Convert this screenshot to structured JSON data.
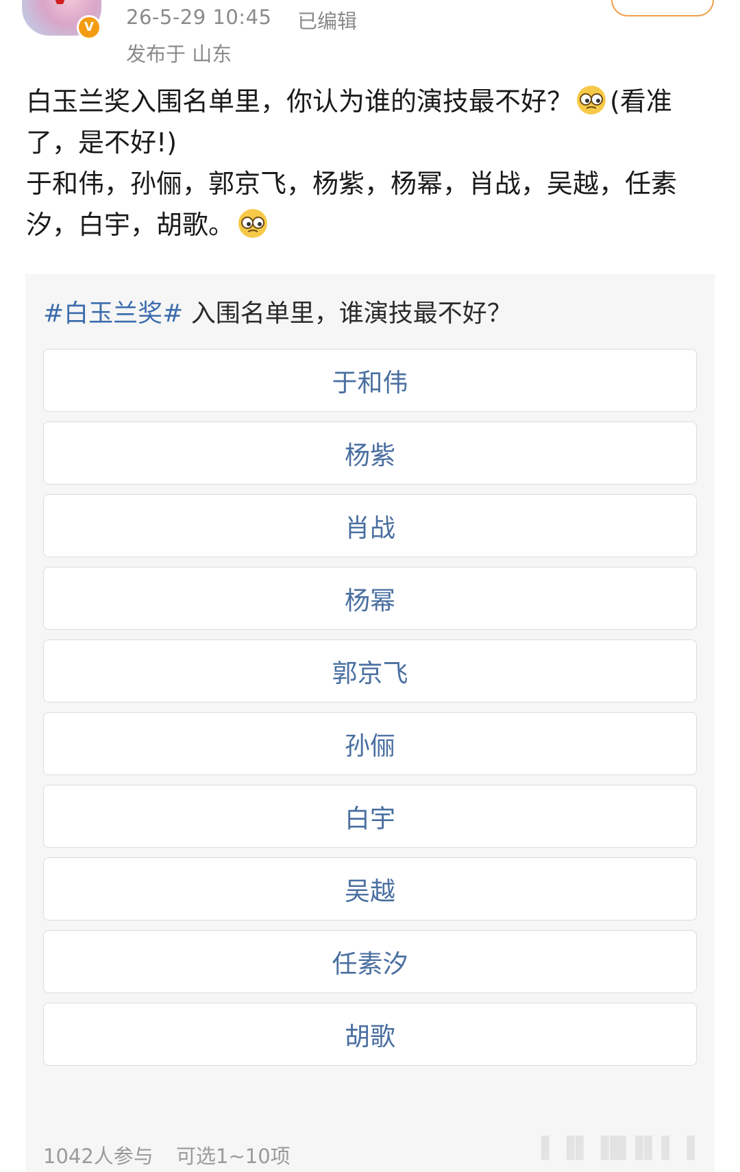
{
  "header": {
    "timestamp": "26-5-29 10:45",
    "edited": "已编辑",
    "location": "发布于 山东",
    "verified_badge": "V"
  },
  "post": {
    "line1": "白玉兰奖入围名单里，你认为谁的演技最不好？",
    "line1_tail": "(看准了，是不好!)",
    "line2": "于和伟，孙俪，郭京飞，杨紫，杨幂，肖战，吴越，任素汐，白宇，胡歌。",
    "emoji_icon": "smirk-glasses-emoji"
  },
  "poll": {
    "topic": "#白玉兰奖#",
    "question": "入围名单里，谁演技最不好？",
    "options": [
      {
        "label": "于和伟"
      },
      {
        "label": "杨紫"
      },
      {
        "label": "肖战"
      },
      {
        "label": "杨幂"
      },
      {
        "label": "郭京飞"
      },
      {
        "label": "孙俪"
      },
      {
        "label": "白宇"
      },
      {
        "label": "吴越"
      },
      {
        "label": "任素汐"
      },
      {
        "label": "胡歌"
      }
    ],
    "participants": "1042人参与",
    "selectable": "可选1~10项"
  },
  "colors": {
    "link": "#3c6cad",
    "option_text": "#4a6fa0",
    "meta": "#8a8a8a",
    "poll_bg": "#f6f6f6",
    "follow_border": "#f0a04b"
  }
}
